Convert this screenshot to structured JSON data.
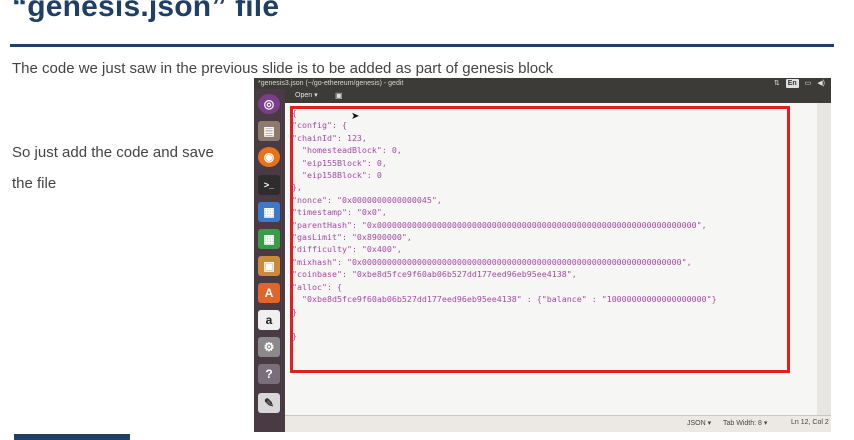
{
  "slide": {
    "title": "“genesis.json” file",
    "intro": "The code we just saw in the previous slide is to be added as part of genesis block",
    "side_line1": "So just add the code and save",
    "side_line2": "the file"
  },
  "window": {
    "title": "*genesis3.json (~/go-ethereum/genesis) - gedit",
    "tray": [
      "⇅",
      "En",
      "▭",
      "◀)"
    ]
  },
  "toolbar": {
    "open_label": "Open ▾",
    "save_icon": "save-icon"
  },
  "launcher": [
    "dash-icon",
    "files-icon",
    "firefox-icon",
    "terminal-icon",
    "writer-icon",
    "calc-icon",
    "archive-icon",
    "software-center-icon",
    "amazon-icon",
    "settings-icon",
    "help-icon",
    "text-editor-icon"
  ],
  "code": {
    "lines": [
      "{",
      "\"config\": {",
      "\"chainId\": 123,",
      "  \"homesteadBlock\": 0,",
      "  \"eip155Block\": 0,",
      "  \"eip158Block\": 0",
      "},",
      "\"nonce\": \"0x0000000000000045\",",
      "\"timestamp\": \"0x0\",",
      "\"parentHash\": \"0x0000000000000000000000000000000000000000000000000000000000000000\",",
      "\"gasLimit\": \"0x8900000\",",
      "\"difficulty\": \"0x400\",",
      "\"mixhash\": \"0x0000000000000000000000000000000000000000000000000000000000000000\",",
      "\"coinbase\": \"0xbe8d5fce9f60ab06b527dd177eed96eb95ee4138\",",
      "\"alloc\": {",
      "  \"0xbe8d5fce9f60ab06b527dd177eed96eb95ee4138\" : {\"balance\" : \"10000000000000000000\"}",
      "}",
      "",
      "}"
    ]
  },
  "statusbar": {
    "language": "JSON ▾",
    "tab_width": "Tab Width: 8 ▾",
    "position": "Ln 12, Col 2"
  },
  "colors": {
    "accent": "#1f3f66",
    "code": "#a54aa8",
    "highlight": "#e02020",
    "launcher": "#4a3a44"
  }
}
